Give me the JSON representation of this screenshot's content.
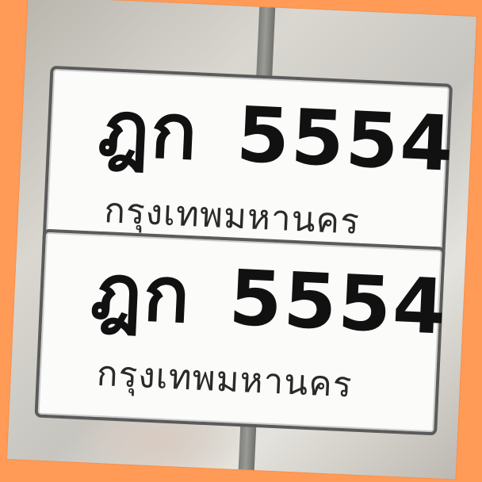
{
  "plates": [
    {
      "letters": "ฎก",
      "number": "5554",
      "province": "กรุงเทพมหานคร"
    },
    {
      "letters": "ฎก",
      "number": "5554",
      "province": "กรุงเทพมหานคร"
    }
  ],
  "colors": {
    "border": "#FF9A57",
    "plate_background": "#fbfbf9",
    "plate_text": "#111111"
  }
}
